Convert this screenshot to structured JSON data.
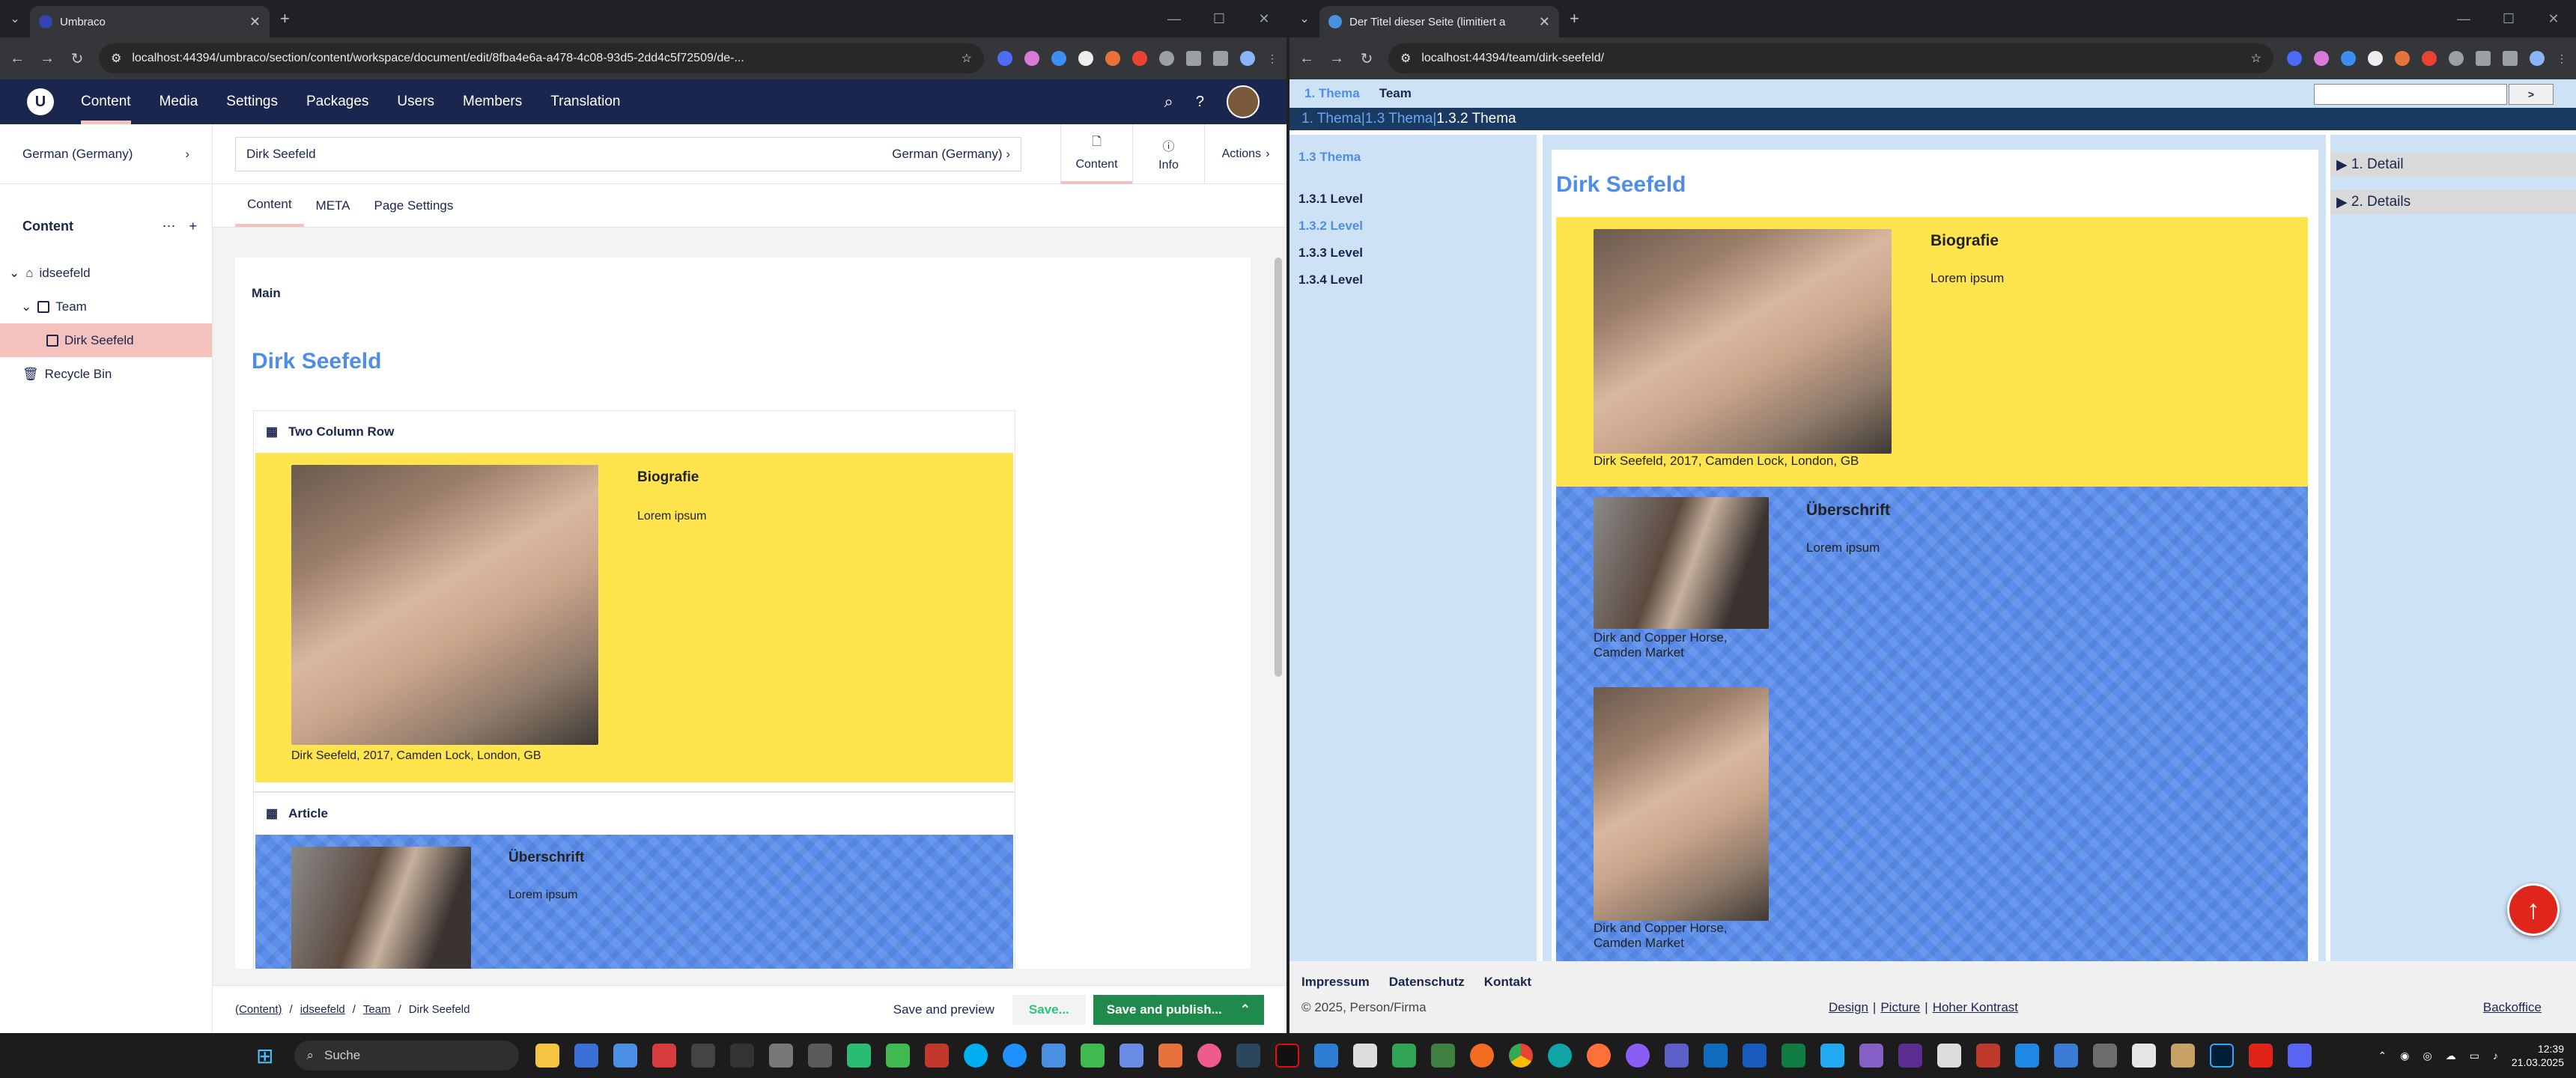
{
  "left_browser": {
    "tab_title": "Umbraco",
    "url": "localhost:44394/umbraco/section/content/workspace/document/edit/8fba4e6a-a478-4c08-93d5-2dd4c5f72509/de-...",
    "header": {
      "nav": [
        "Content",
        "Media",
        "Settings",
        "Packages",
        "Users",
        "Members",
        "Translation"
      ],
      "active": "Content"
    },
    "culture": "German (Germany)",
    "tree": {
      "title": "Content",
      "items": [
        "idseefeld",
        "Team",
        "Dirk Seefeld",
        "Recycle Bin"
      ]
    },
    "workspace": {
      "name": "Dirk Seefeld",
      "culture": "German (Germany)",
      "apps": [
        "Content",
        "Info",
        "Actions"
      ],
      "tabs": [
        "Content",
        "META",
        "Page Settings"
      ],
      "group": "Main",
      "page_title": "Dirk Seefeld",
      "block1": {
        "label": "Two Column Row",
        "heading": "Biografie",
        "text": "Lorem ipsum",
        "caption": "Dirk Seefeld, 2017, Camden Lock, London, GB"
      },
      "block2": {
        "label": "Article",
        "heading": "Überschrift",
        "text": "Lorem ipsum"
      }
    },
    "footer": {
      "breadcrumbs": [
        "(Content)",
        "idseefeld",
        "Team",
        "Dirk Seefeld"
      ],
      "save_preview": "Save and preview",
      "save": "Save...",
      "save_publish": "Save and publish..."
    }
  },
  "right_browser": {
    "tab_title": "Der Titel dieser Seite (limitiert a",
    "url": "localhost:44394/team/dirk-seefeld/",
    "top_nav": [
      "1. Thema",
      "Team"
    ],
    "search_button": ">",
    "breadcrumb": [
      "1. Thema",
      "|",
      "1.3 Thema",
      "|",
      "1.3.2 Thema"
    ],
    "side_nav": {
      "title": "1.3 Thema",
      "items": [
        "1.3.1 Level",
        "1.3.2 Level",
        "1.3.3 Level",
        "1.3.4 Level"
      ]
    },
    "content": {
      "title": "Dirk Seefeld",
      "bio_heading": "Biografie",
      "bio_text": "Lorem ipsum",
      "bio_caption": "Dirk Seefeld, 2017, Camden Lock, London, GB",
      "article_heading": "Überschrift",
      "article_text": "Lorem ipsum",
      "caption1a": "Dirk and Copper Horse,",
      "caption1b": "Camden Market",
      "caption2a": "Dirk and Copper Horse,",
      "caption2b": "Camden Market"
    },
    "details": [
      "1. Detail",
      "2. Details"
    ],
    "footer": {
      "links": [
        "Impressum",
        "Datenschutz",
        "Kontakt"
      ],
      "copyright": "© 2025, Person/Firma",
      "center_links": [
        "Design",
        "|",
        "Picture",
        "|",
        "Hoher Kontrast"
      ],
      "backoffice": "Backoffice"
    }
  },
  "taskbar": {
    "search": "Suche",
    "time": "12:39",
    "date": "21.03.2025"
  },
  "colors": {
    "umbraco_header": "#1b264f",
    "accent_pink": "#f5c1bc",
    "yellow_block": "#ffe44d",
    "blue_block": "#5b8eea",
    "publish_green": "#1f8a4c"
  }
}
